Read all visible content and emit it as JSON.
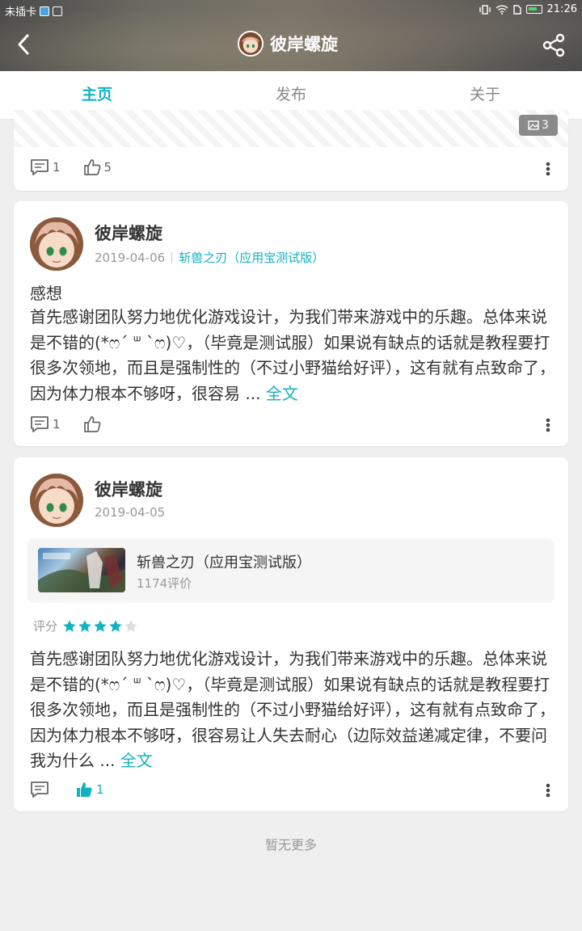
{
  "status_bar": {
    "carrier": "未插卡",
    "time": "21:26"
  },
  "header": {
    "title": "彼岸螺旋"
  },
  "tabs": [
    {
      "label": "主页",
      "active": true
    },
    {
      "label": "发布",
      "active": false
    },
    {
      "label": "关于",
      "active": false
    }
  ],
  "post1": {
    "image_count": "3",
    "comments": "1",
    "likes": "5"
  },
  "post2": {
    "user": "彼岸螺旋",
    "date": "2019-04-06",
    "game": "斩兽之刃（应用宝测试版）",
    "title": "感想",
    "body": "首先感谢团队努力地优化游戏设计，为我们带来游戏中的乐趣。总体来说是不错的(*ෆ´ ᐜ `ෆ)♡，（毕竟是测试服）如果说有缺点的话就是教程要打很多次领地，而且是强制性的（不过小野猫给好评），这有就有点致命了，因为体力根本不够呀，很容易 ... ",
    "full_text_label": "全文",
    "comments": "1",
    "likes": ""
  },
  "post3": {
    "user": "彼岸螺旋",
    "date": "2019-04-05",
    "game_card": {
      "name": "斩兽之刃（应用宝测试版）",
      "reviews": "1174评价"
    },
    "rating_label": "评分",
    "rating": 4,
    "rating_max": 5,
    "body": "首先感谢团队努力地优化游戏设计，为我们带来游戏中的乐趣。总体来说是不错的(*ෆ´ ᐜ `ෆ)♡，（毕竟是测试服）如果说有缺点的话就是教程要打很多次领地，而且是强制性的（不过小野猫给好评），这有就有点致命了，因为体力根本不够呀，很容易让人失去耐心（边际效益递减定律，不要问我为什么 ... ",
    "full_text_label": "全文",
    "comments": "",
    "likes": "1"
  },
  "footer": {
    "no_more": "暂无更多"
  },
  "colors": {
    "accent": "#12b2c0",
    "background": "#efefef"
  }
}
